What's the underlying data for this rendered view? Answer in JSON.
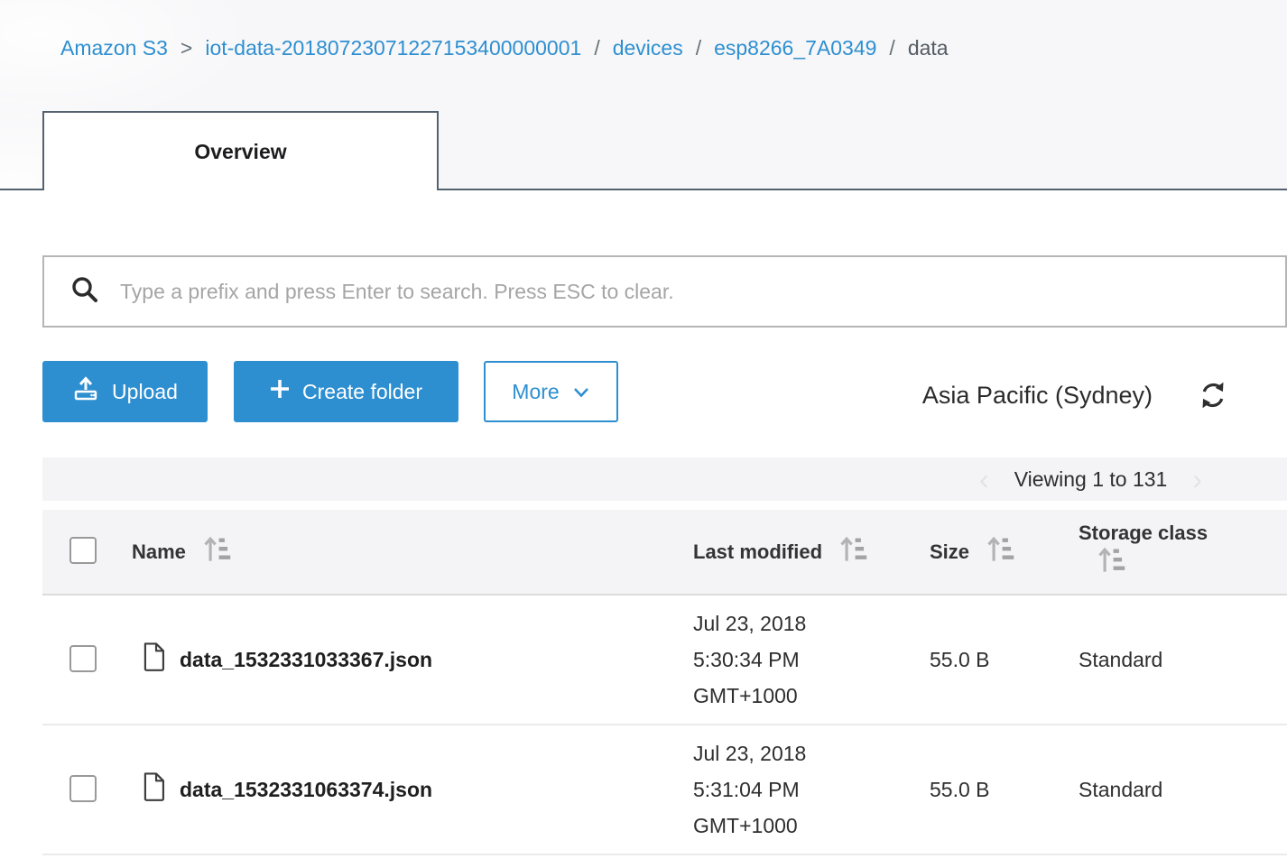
{
  "breadcrumb": {
    "root_separator": ">",
    "separator": "/",
    "items": [
      {
        "label": "Amazon S3"
      },
      {
        "label": "iot-data-20180723071227153400000001"
      },
      {
        "label": "devices"
      },
      {
        "label": "esp8266_7A0349"
      },
      {
        "label": "data"
      }
    ]
  },
  "tabs": [
    {
      "label": "Overview",
      "active": true
    }
  ],
  "search": {
    "value": "",
    "placeholder": "Type a prefix and press Enter to search. Press ESC to clear."
  },
  "toolbar": {
    "upload_label": "Upload",
    "create_folder_label": "Create folder",
    "more_label": "More",
    "region_label": "Asia Pacific (Sydney)"
  },
  "pagination": {
    "viewing_label": "Viewing 1 to 131",
    "prev_symbol": "‹",
    "next_symbol": "›"
  },
  "table": {
    "headers": {
      "name": "Name",
      "last_modified": "Last modified",
      "size": "Size",
      "storage_class": "Storage class"
    },
    "rows": [
      {
        "name": "data_1532331033367.json",
        "modified_date": "Jul 23, 2018",
        "modified_time": "5:30:34 PM",
        "modified_tz": "GMT+1000",
        "size": "55.0 B",
        "storage_class": "Standard"
      },
      {
        "name": "data_1532331063374.json",
        "modified_date": "Jul 23, 2018",
        "modified_time": "5:31:04 PM",
        "modified_tz": "GMT+1000",
        "size": "55.0 B",
        "storage_class": "Standard"
      }
    ]
  },
  "icons": {
    "search": "search-icon",
    "upload": "upload-icon",
    "plus": "plus-icon",
    "chevron_down": "chevron-down-icon",
    "refresh": "refresh-icon",
    "sort": "sort-icon",
    "file": "file-icon"
  },
  "colors": {
    "accent_blue": "#2e8fd0",
    "tab_border": "#54616e",
    "top_background": "#f7f7f9",
    "bar_background": "#f4f4f6",
    "text_dark": "#333333",
    "muted_gray": "#a5a5a5"
  }
}
